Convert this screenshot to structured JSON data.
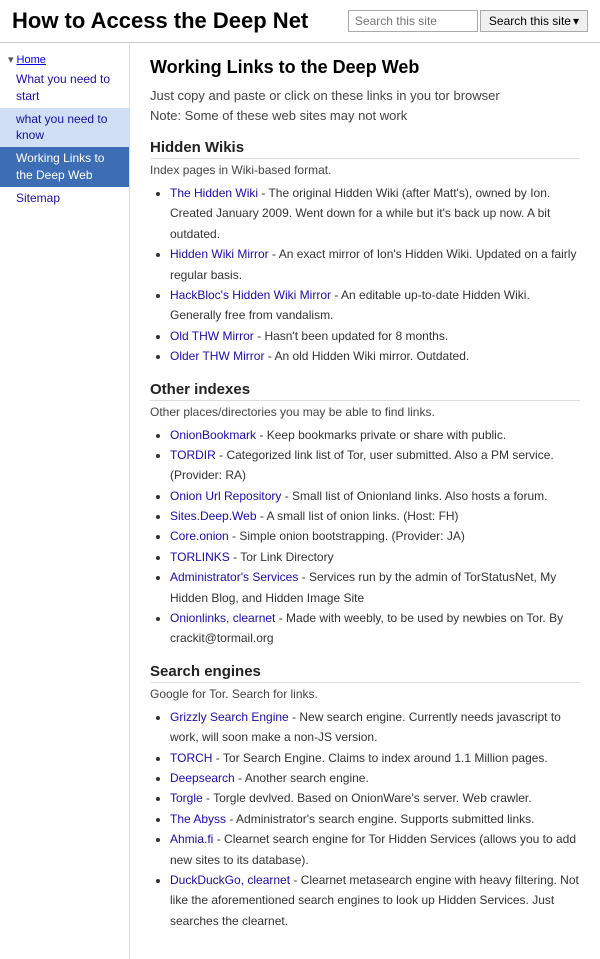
{
  "header": {
    "title": "How to Access the Deep Net",
    "search_placeholder": "Search this site",
    "search_button": "Search this site",
    "search_dropdown": "▾"
  },
  "sidebar": {
    "section_arrow": "▾",
    "home_label": "Home",
    "items": [
      {
        "id": "what-you-need-to-start",
        "label": "What you need to start",
        "active": false,
        "parent_active": false
      },
      {
        "id": "what-you-need-to-know",
        "label": "what you need to know",
        "active": false,
        "parent_active": true
      },
      {
        "id": "working-links",
        "label": "Working Links to the Deep Web",
        "active": true,
        "parent_active": false
      },
      {
        "id": "sitemap",
        "label": "Sitemap",
        "active": false,
        "parent_active": false
      }
    ]
  },
  "main": {
    "title": "Working Links to the Deep Web",
    "intro_line1": "Just copy and paste or click on these links in you tor browser",
    "intro_line2": "Note: Some of these web sites may not work",
    "sections": [
      {
        "id": "hidden-wikis",
        "heading": "Hidden Wikis",
        "desc": "Index pages in Wiki-based format.",
        "items": [
          {
            "link": "The Hidden Wiki",
            "text": " - The original Hidden Wiki (after Matt's), owned by Ion. Created January 2009. Went down for a while but it's back up now. A bit outdated."
          },
          {
            "link": "Hidden Wiki Mirror",
            "text": " - An exact mirror of Ion's Hidden Wiki. Updated on a fairly regular basis."
          },
          {
            "link": "HackBloc's Hidden Wiki Mirror",
            "text": " - An editable up-to-date Hidden Wiki. Generally free from vandalism."
          },
          {
            "link": "Old THW Mirror",
            "text": " - Hasn't been updated for 8 months."
          },
          {
            "link": "Older THW Mirror",
            "text": " - An old Hidden Wiki mirror. Outdated."
          }
        ]
      },
      {
        "id": "other-indexes",
        "heading": "Other indexes",
        "desc": "Other places/directories you may be able to find links.",
        "items": [
          {
            "link": "OnionBookmark",
            "text": " - Keep bookmarks private or share with public."
          },
          {
            "link": "TORDIR",
            "text": " - Categorized link list of Tor, user submitted. Also a PM service. (Provider: RA)"
          },
          {
            "link": "Onion Url Repository",
            "text": " - Small list of Onionland links. Also hosts a forum."
          },
          {
            "link": "Sites.Deep.Web",
            "text": " - A small list of onion links. (Host: FH)"
          },
          {
            "link": "Core.onion",
            "text": " - Simple onion bootstrapping. (Provider: JA)"
          },
          {
            "link": "TORLINKS",
            "text": " - Tor Link Directory"
          },
          {
            "link": "Administrator's Services",
            "text": " - Services run by the admin of TorStatusNet, My Hidden Blog, and Hidden Image Site"
          },
          {
            "link": "Onionlinks, clearnet",
            "text": " - Made with weebly, to be used by newbies on Tor. By crackit@tormail.org"
          }
        ]
      },
      {
        "id": "search-engines",
        "heading": "Search engines",
        "desc": "Google for Tor. Search for links.",
        "items": [
          {
            "link": "Grizzly Search Engine",
            "text": " - New search engine. Currently needs javascript to work, will soon make a non-JS version."
          },
          {
            "link": "TORCH",
            "text": " - Tor Search Engine. Claims to index around 1.1 Million pages."
          },
          {
            "link": "Deepsearch",
            "text": " - Another search engine."
          },
          {
            "link": "Torgle",
            "text": " - Torgle devlved. Based on OnionWare's server. Web crawler."
          },
          {
            "link": "The Abyss",
            "text": " - Administrator's search engine. Supports submitted links."
          },
          {
            "link": "Ahmia.fi",
            "text": " - Clearnet search engine for Tor Hidden Services (allows you to add new sites to its database)."
          },
          {
            "link": "DuckDuckGo, clearnet",
            "text": " - Clearnet metasearch engine with heavy filtering. Not like the aforementioned search engines to look up Hidden Services. Just searches the clearnet."
          }
        ]
      }
    ]
  }
}
